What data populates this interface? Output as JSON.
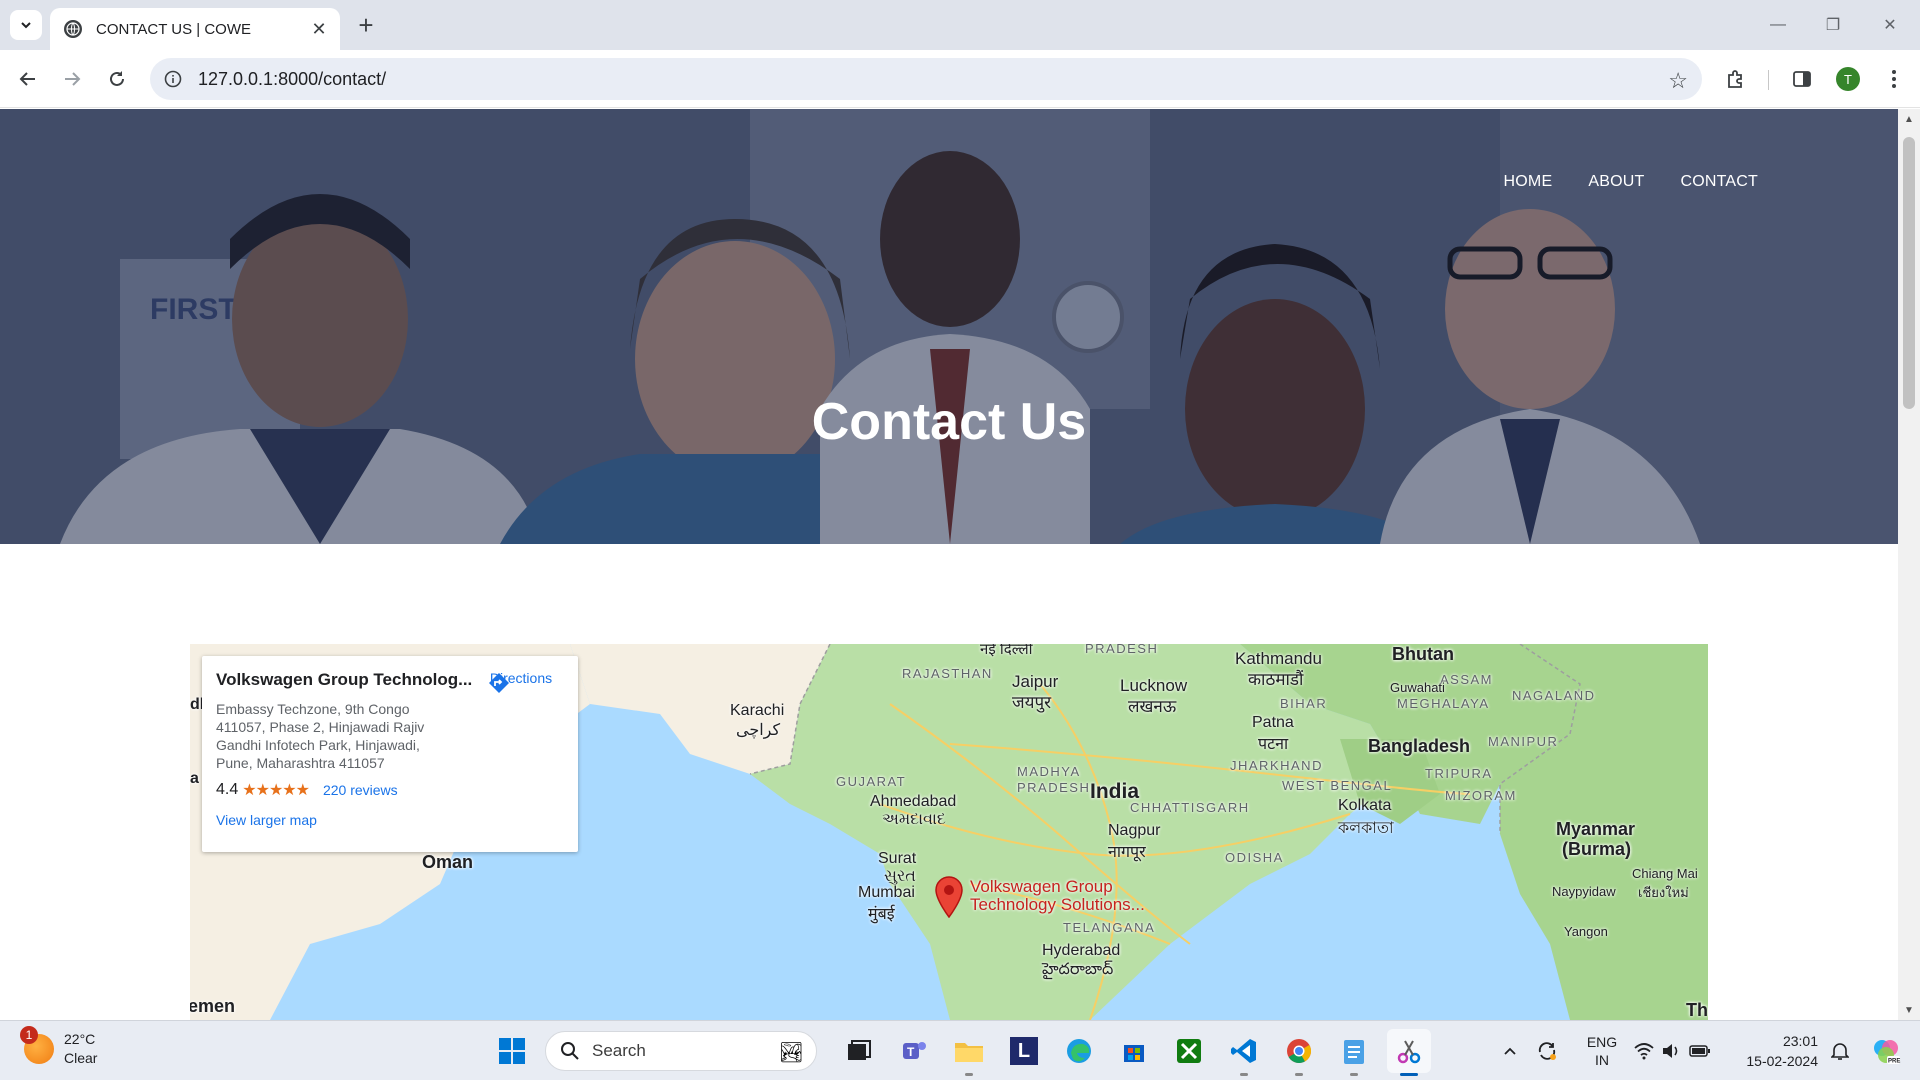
{
  "browser": {
    "tab_title": "CONTACT US | COWE",
    "url": "127.0.0.1:8000/contact/",
    "profile_initial": "T"
  },
  "page": {
    "nav": [
      {
        "label": "HOME"
      },
      {
        "label": "ABOUT"
      },
      {
        "label": "CONTACT"
      }
    ],
    "hero_title": "Contact Us",
    "hero_sign": "FIRST STAT"
  },
  "map": {
    "place_name": "Volkswagen Group Technolog...",
    "address": "Embassy Techzone, 9th Congo 411057, Phase 2, Hinjawadi Rajiv Gandhi Infotech Park, Hinjawadi, Pune, Maharashtra 411057",
    "rating": "4.4",
    "stars": "★★★★★",
    "reviews": "220 reviews",
    "directions": "Directions",
    "larger_map": "View larger map",
    "pin_label_1": "Volkswagen Group",
    "pin_label_2": "Technology Solutions...",
    "labels": {
      "delhi": "नई दिल्ली",
      "pradesh_top": "PRADESH",
      "rajasthan": "RAJASTHAN",
      "jaipur": "Jaipur",
      "jaipur_hi": "जयपुर",
      "lucknow": "Lucknow",
      "lucknow_hi": "लखनऊ",
      "kathmandu": "Kathmandu",
      "kathmandu_hi": "काठमाडौं",
      "bhutan": "Bhutan",
      "assam": "ASSAM",
      "guwahati": "Guwahati",
      "meghalaya": "MEGHALAYA",
      "nagaland": "NAGALAND",
      "bihar": "BIHAR",
      "patna": "Patna",
      "patna_hi": "पटना",
      "bangladesh": "Bangladesh",
      "manipur": "MANIPUR",
      "tripura": "TRIPURA",
      "karachi": "Karachi",
      "karachi_ur": "کراچی",
      "gujarat": "GUJARAT",
      "ahmedabad": "Ahmedabad",
      "ahmedabad_gu": "અમદાવાદ",
      "madhya": "MADHYA",
      "pradesh": "PRADESH",
      "india": "India",
      "jharkhand": "JHARKHAND",
      "westbengal": "WEST BENGAL",
      "kolkata": "Kolkata",
      "kolkata_bn": "কলকাতা",
      "mizoram": "MIZORAM",
      "chhattisgarh": "CHHATTISGARH",
      "nagpur": "Nagpur",
      "nagpur_hi": "नागपूर",
      "myanmar": "Myanmar",
      "burma": "(Burma)",
      "oman": "Oman",
      "surat": "Surat",
      "surat_gu": "સુરત",
      "odisha": "ODISHA",
      "mumbai": "Mumbai",
      "mumbai_hi": "मुंबई",
      "chiangmai": "Chiang Mai",
      "chiangmai_th": "เชียงใหม่",
      "naypyidaw": "Naypyidaw",
      "telangana": "TELANGANA",
      "hyderabad": "Hyderabad",
      "hyderabad_te": "హైదరాబాద్",
      "yangon": "Yangon",
      "yemen": "emen",
      "th": "Th",
      "dh": "dh",
      "a": "a"
    }
  },
  "taskbar": {
    "temp": "22°C",
    "condition": "Clear",
    "weather_badge": "1",
    "search": "Search",
    "lang_1": "ENG",
    "lang_2": "IN",
    "time": "23:01",
    "date": "15-02-2024"
  }
}
